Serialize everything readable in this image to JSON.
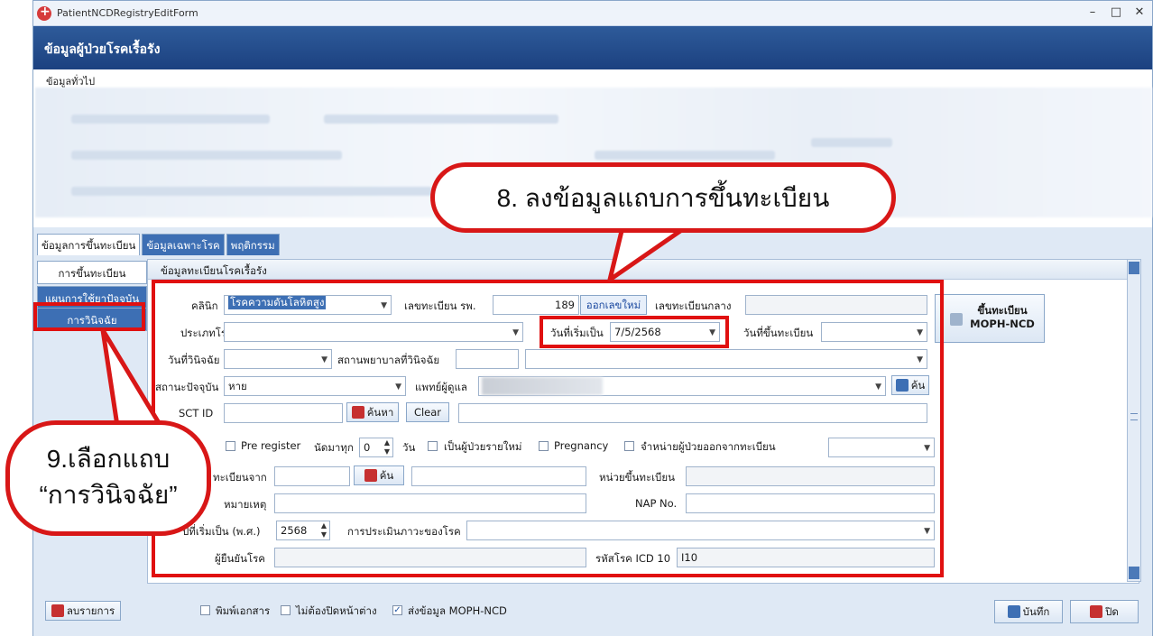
{
  "window": {
    "title": "PatientNCDRegistryEditForm",
    "ctrl_min": "–",
    "ctrl_max": "□",
    "ctrl_close": "✕"
  },
  "header": {
    "title": "ข้อมูลผู้ป่วยโรคเรื้อรัง"
  },
  "general": {
    "label": "ข้อมูลทั่วไป"
  },
  "tabs": [
    "ข้อมูลการขึ้นทะเบียน",
    "ข้อมูลเฉพาะโรค",
    "พฤติกรรม"
  ],
  "nav": [
    "การขึ้นทะเบียน",
    "แผนการใช้ยาปัจจุบัน",
    "การวินิจฉัย"
  ],
  "panel": {
    "title": "ข้อมูลทะเบียนโรคเรื้อรัง"
  },
  "form": {
    "clinic_label": "คลินิก",
    "clinic_value": "โรคความดันโลหิตสูง",
    "hn_label": "เลขทะเบียน รพ.",
    "hn_value": "189",
    "hn_button": "ออกเลขใหม่",
    "central_label": "เลขทะเบียนกลาง",
    "disease_type_label": "ประเภทโรค",
    "start_date_label": "วันที่เริ่มเป็น",
    "start_date_value": "7/5/2568",
    "register_date_label": "วันที่ขึ้นทะเบียน",
    "diag_date_label": "วันที่วินิจฉัย",
    "diag_hospital_label": "สถานพยาบาลที่วินิจฉัย",
    "status_label": "สถานะปัจจุบัน",
    "status_value": "หาย",
    "doctor_label": "แพทย์ผู้ดูแล",
    "doctor_search": "ค้น",
    "sct_label": "SCT ID",
    "sct_search": "ค้นหา",
    "sct_clear": "Clear",
    "pre_register": "Pre register",
    "appoint_label": "นัดมาทุก",
    "appoint_value": "0",
    "appoint_unit": "วัน",
    "new_patient": "เป็นผู้ป่วยรายใหม่",
    "pregnancy": "Pregnancy",
    "discharge": "จำหน่ายผู้ป่วยออกจากทะเบียน",
    "from_label": "ทะเบียนจาก",
    "from_search": "ค้น",
    "unit_label": "หน่วยขึ้นทะเบียน",
    "note_label": "หมายเหตุ",
    "nap_label": "NAP No.",
    "year_label": "ปีที่เริ่มเป็น (พ.ศ.)",
    "year_value": "2568",
    "assess_label": "การประเมินภาวะของโรค",
    "confirm_label": "ผู้ยืนยันโรค",
    "icd_label": "รหัสโรค ICD 10",
    "icd_value": "I10"
  },
  "moph_button": {
    "line1": "ขึ้นทะเบียน",
    "line2": "MOPH-NCD"
  },
  "footer": {
    "delete": "ลบรายการ",
    "print": "พิมพ์เอกสาร",
    "no_close": "ไม่ต้องปิดหน้าต่าง",
    "send": "ส่งข้อมูล MOPH-NCD",
    "save": "บันทึก",
    "close": "ปิด"
  },
  "callouts": {
    "step8": "8. ลงข้อมูลแถบการขึ้นทะเบียน",
    "step9_line1": "9.เลือกแถบ",
    "step9_line2": "“การวินิจฉัย”"
  },
  "colors": {
    "accent": "#3d6fb4",
    "header": "#1c4180",
    "highlight": "#e01010"
  }
}
